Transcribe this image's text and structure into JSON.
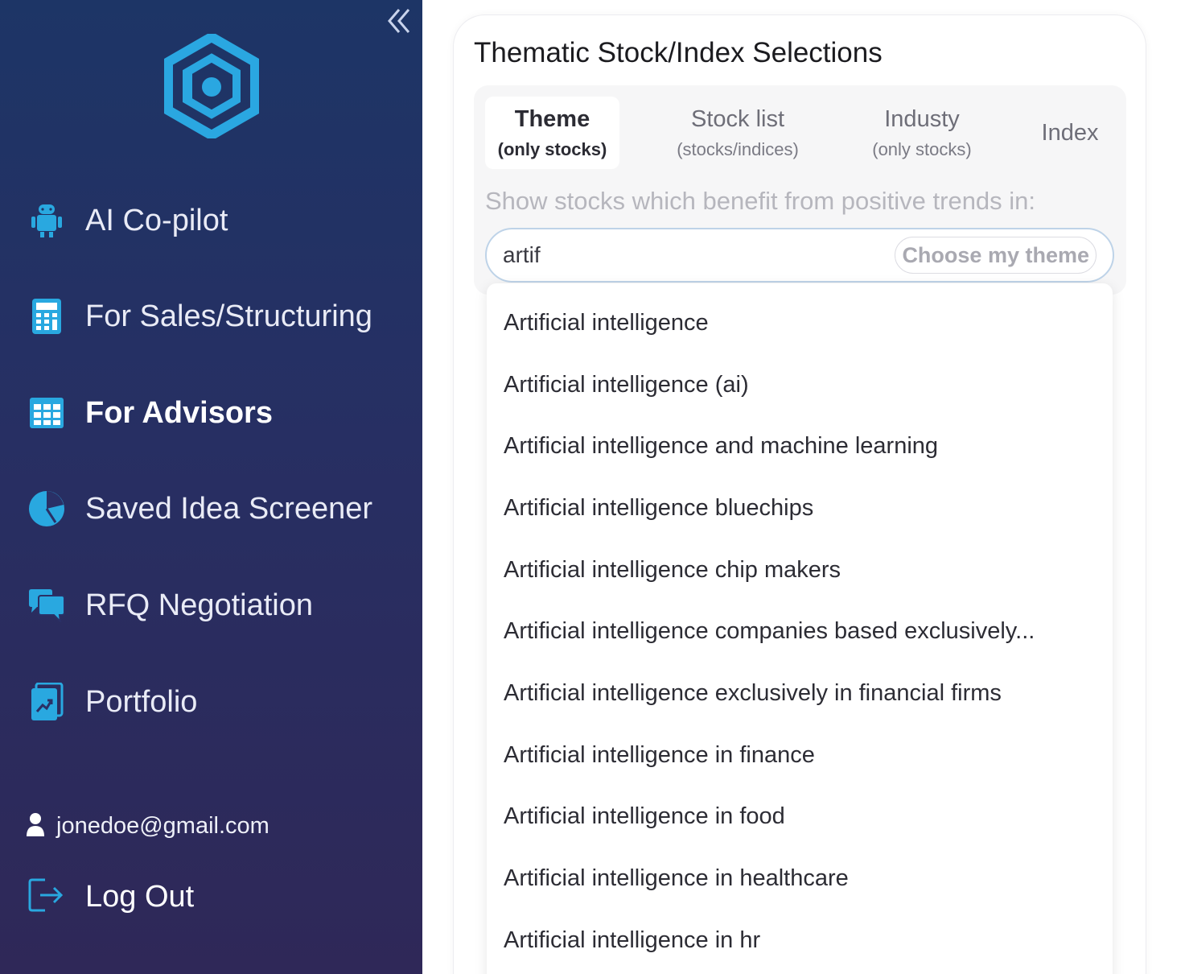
{
  "sidebar": {
    "nav_items": [
      {
        "label": "AI Co-pilot",
        "icon": "robot-icon",
        "active": false
      },
      {
        "label": "For Sales/Structuring",
        "icon": "calculator-icon",
        "active": false
      },
      {
        "label": "For Advisors",
        "icon": "table-grid-icon",
        "active": true
      },
      {
        "label": "Saved Idea Screener",
        "icon": "pie-chart-icon",
        "active": false
      },
      {
        "label": "RFQ Negotiation",
        "icon": "chat-bubbles-icon",
        "active": false
      },
      {
        "label": "Portfolio",
        "icon": "portfolio-chart-icon",
        "active": false
      }
    ],
    "user_email": "jonedoe@gmail.com",
    "logout_label": "Log Out"
  },
  "main": {
    "title": "Thematic Stock/Index Selections",
    "tabs": [
      {
        "label": "Theme",
        "sub": "(only stocks)",
        "active": true
      },
      {
        "label": "Stock list",
        "sub": "(stocks/indices)",
        "active": false
      },
      {
        "label": "Industy",
        "sub": "(only stocks)",
        "active": false
      },
      {
        "label": "Index",
        "sub": "",
        "active": false
      }
    ],
    "prompt": "Show stocks which benefit from positive trends in:",
    "search_value": "artif",
    "choose_button": "Choose my theme",
    "suggestions": [
      "Artificial intelligence",
      "Artificial intelligence (ai)",
      "Artificial intelligence and machine learning",
      "Artificial intelligence bluechips",
      "Artificial intelligence chip makers",
      "Artificial intelligence companies based exclusively...",
      "Artificial intelligence exclusively in financial firms",
      "Artificial intelligence in finance",
      "Artificial intelligence in food",
      "Artificial intelligence in healthcare",
      "Artificial intelligence in hr"
    ]
  },
  "colors": {
    "accent": "#29a8e0",
    "sidebar_top": "#1d3566",
    "sidebar_bottom": "#2f2858"
  }
}
